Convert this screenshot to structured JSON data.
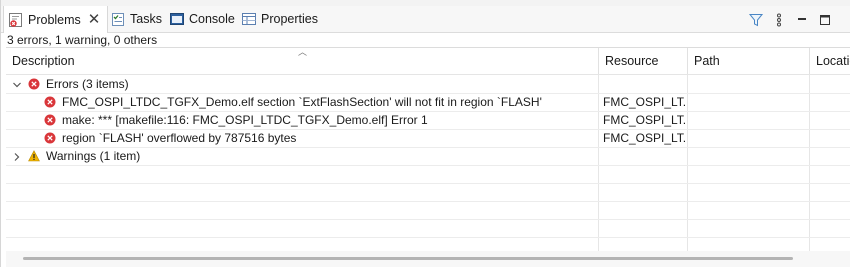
{
  "tabs": [
    {
      "label": "Problems",
      "icon": "problems-icon",
      "active": true,
      "closable": true
    },
    {
      "label": "Tasks",
      "icon": "tasks-icon"
    },
    {
      "label": "Console",
      "icon": "console-icon"
    },
    {
      "label": "Properties",
      "icon": "properties-icon"
    }
  ],
  "toolbar": {
    "filter_icon": "filter-icon",
    "menu_icon": "view-menu-icon",
    "minimize_icon": "minimize-icon",
    "maximize_icon": "maximize-icon"
  },
  "summary": "3 errors, 1 warning, 0 others",
  "columns": [
    "Description",
    "Resource",
    "Path",
    "Location"
  ],
  "groups": {
    "errors": {
      "label": "Errors (3 items)",
      "expanded": true,
      "items": [
        {
          "description": "FMC_OSPI_LTDC_TGFX_Demo.elf section `ExtFlashSection' will not fit in region `FLASH'",
          "resource": "FMC_OSPI_LT..."
        },
        {
          "description": "make: *** [makefile:116: FMC_OSPI_LTDC_TGFX_Demo.elf] Error 1",
          "resource": "FMC_OSPI_LT..."
        },
        {
          "description": "region `FLASH' overflowed by 787516 bytes",
          "resource": "FMC_OSPI_LT..."
        }
      ]
    },
    "warnings": {
      "label": "Warnings (1 item)",
      "expanded": false
    }
  },
  "colors": {
    "error": "#d9363a",
    "warning": "#f1b400",
    "tab_active_bg": "#ffffff",
    "tabbar_bg": "#f7f7f7",
    "grid": "#ececec"
  }
}
